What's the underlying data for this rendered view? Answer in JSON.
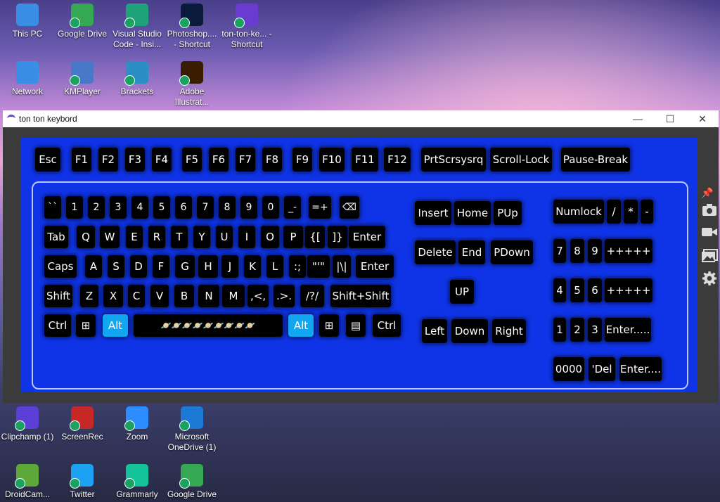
{
  "desktop": {
    "top_icons": [
      {
        "label": "This PC",
        "color": "#3a8ee6"
      },
      {
        "label": "Google Drive",
        "color": "#34a853"
      },
      {
        "label": "Visual Studio Code - Insi...",
        "color": "#1fa37a"
      },
      {
        "label": "Photoshop.... - Shortcut",
        "color": "#0a1a3a"
      },
      {
        "label": "ton-ton-ke... - Shortcut",
        "color": "#6a3bd1"
      },
      {
        "label": "Network",
        "color": "#3a8ee6"
      },
      {
        "label": "KMPlayer",
        "color": "#4a78c8"
      },
      {
        "label": "Brackets",
        "color": "#2b8fc6"
      },
      {
        "label": "Adobe Illustrat...",
        "color": "#3a1c00"
      }
    ],
    "bottom_icons": [
      {
        "label": "Clipchamp (1)",
        "color": "#5b3fd6"
      },
      {
        "label": "ScreenRec",
        "color": "#c62828"
      },
      {
        "label": "Zoom",
        "color": "#2d8cff"
      },
      {
        "label": "Microsoft OneDrive (1)",
        "color": "#1c79d6"
      },
      {
        "label": "DroidCam...",
        "color": "#5ea83a"
      },
      {
        "label": "Twitter",
        "color": "#1da1f2"
      },
      {
        "label": "Grammarly",
        "color": "#15c39a"
      },
      {
        "label": "Google Drive",
        "color": "#34a853"
      }
    ]
  },
  "window": {
    "title": "ton ton keybord",
    "minimize": "—",
    "maximize": "☐",
    "close": "✕"
  },
  "keyboard": {
    "fn_row": [
      "Esc",
      "F1",
      "F2",
      "F3",
      "F4",
      "F5",
      "F6",
      "F7",
      "F8",
      "F9",
      "F10",
      "F11",
      "F12",
      "PrtScrsysrq",
      "Scroll-Lock",
      "Pause-Break"
    ],
    "row1": [
      "`` ",
      "1",
      "2",
      "3",
      "4",
      "5",
      "6",
      "7",
      "8",
      "9",
      "0",
      "_-",
      "=+",
      "⌫"
    ],
    "row2": [
      "Tab",
      "Q",
      "W",
      "E",
      "R",
      "T",
      "Y",
      "U",
      "I",
      "O",
      "P",
      "{[",
      "]}",
      "Enter"
    ],
    "row3": [
      "Caps",
      "A",
      "S",
      "D",
      "F",
      "G",
      "H",
      "J",
      "K",
      "L",
      ":;",
      "\"'\"",
      "|\\|",
      "Enter"
    ],
    "row4": [
      "Shift",
      "Z",
      "X",
      "C",
      "V",
      "B",
      "N",
      "M",
      ",<,",
      ".>.",
      "/?/",
      "Shift+Shift"
    ],
    "row5": [
      "Ctrl",
      "⊞",
      "Alt",
      "🪐🪐🪐🪐🪐🪐🪐🪐🪐",
      "Alt",
      "⊞",
      "▤",
      "Ctrl"
    ],
    "nav": [
      "Insert",
      "Home",
      "PUp",
      "Delete",
      "End",
      "PDown",
      "UP",
      "Left",
      "Down",
      "Right"
    ],
    "numpad": [
      "Numlock",
      "/",
      "*",
      "-",
      "7",
      "8",
      "9",
      "+++++",
      "4",
      "5",
      "6",
      "+++++",
      "1",
      "2",
      "3",
      "Enter.....",
      "0000",
      "'Del",
      "Enter...."
    ]
  }
}
